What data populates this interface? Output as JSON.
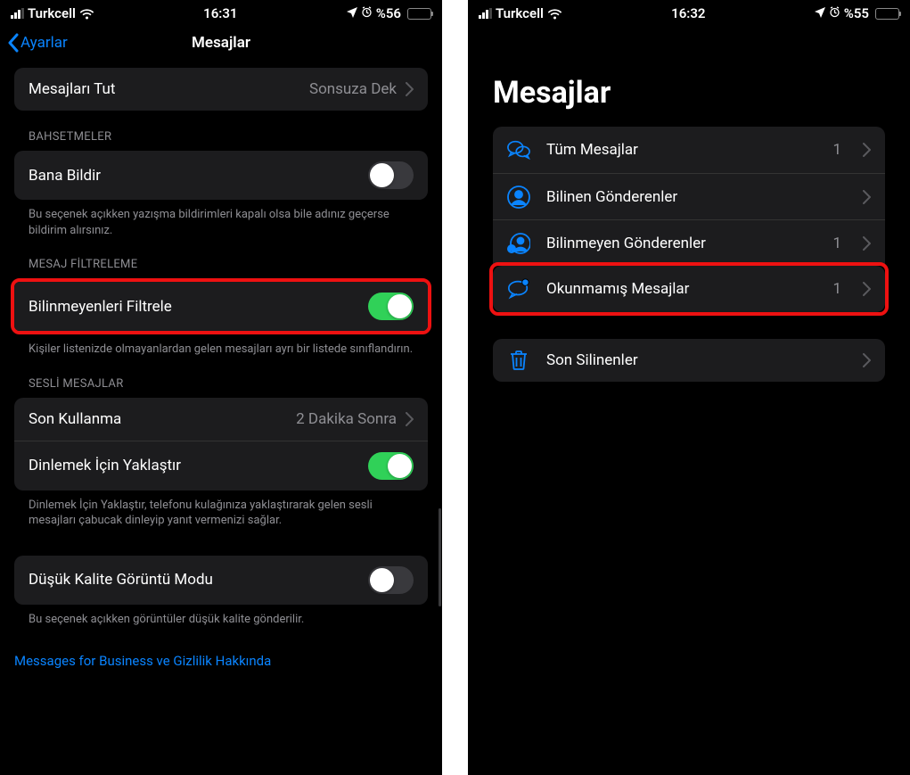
{
  "left": {
    "status": {
      "carrier": "Turkcell",
      "time": "16:31",
      "battery": "%56",
      "battery_pct": 56
    },
    "nav": {
      "back": "Ayarlar",
      "title": "Mesajlar"
    },
    "keep": {
      "label": "Mesajları Tut",
      "value": "Sonsuza Dek"
    },
    "mentions": {
      "header": "BAHSETMELER",
      "notify": "Bana Bildir",
      "footer": "Bu seçenek açıkken yazışma bildirimleri kapalı olsa bile adınız geçerse bildirim alırsınız."
    },
    "filter": {
      "header": "MESAJ FİLTRELEME",
      "label": "Bilinmeyenleri Filtrele",
      "footer": "Kişiler listenizde olmayanlardan gelen mesajları ayrı bir listede sınıflandırın."
    },
    "audio": {
      "header": "SESLİ MESAJLAR",
      "expire_label": "Son Kullanma",
      "expire_value": "2 Dakika Sonra",
      "raise_label": "Dinlemek İçin Yaklaştır",
      "footer": "Dinlemek İçin Yaklaştır, telefonu kulağınıza yaklaştırarak gelen sesli mesajları çabucak dinleyip yanıt vermenizi sağlar."
    },
    "lowq": {
      "label": "Düşük Kalite Görüntü Modu",
      "footer": "Bu seçenek açıkken görüntüler düşük kalite gönderilir."
    },
    "link": "Messages for Business ve Gizlilik Hakkında"
  },
  "right": {
    "status": {
      "carrier": "Turkcell",
      "time": "16:32",
      "battery": "%55",
      "battery_pct": 55
    },
    "title": "Mesajlar",
    "filters": {
      "all": {
        "label": "Tüm Mesajlar",
        "count": "1"
      },
      "known": {
        "label": "Bilinen Gönderenler"
      },
      "unknown": {
        "label": "Bilinmeyen Gönderenler",
        "count": "1"
      },
      "unread": {
        "label": "Okunmamış Mesajlar",
        "count": "1"
      }
    },
    "deleted": {
      "label": "Son Silinenler"
    }
  }
}
